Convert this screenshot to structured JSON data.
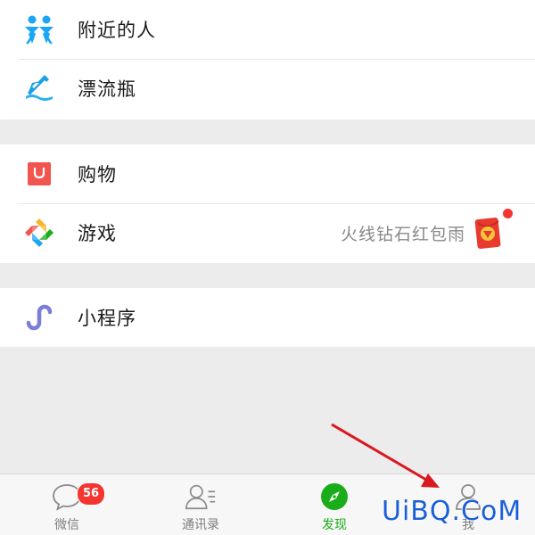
{
  "sections": [
    {
      "items": [
        {
          "label": "附近的人",
          "icon": "people-nearby-icon",
          "color": "#1ba6f5"
        },
        {
          "label": "漂流瓶",
          "icon": "drift-bottle-icon",
          "color": "#1aa0e8"
        }
      ]
    },
    {
      "items": [
        {
          "label": "购物",
          "icon": "shopping-bag-icon",
          "color": "#f0554f"
        },
        {
          "label": "游戏",
          "icon": "game-icon",
          "right_text": "火线钻石红包雨",
          "right_icon": "red-envelope-icon"
        }
      ]
    },
    {
      "items": [
        {
          "label": "小程序",
          "icon": "mini-program-icon",
          "color": "#7b7ed9"
        }
      ]
    }
  ],
  "tabbar": {
    "tabs": [
      {
        "label": "微信",
        "icon": "chat-icon",
        "badge": "56"
      },
      {
        "label": "通讯录",
        "icon": "contacts-icon"
      },
      {
        "label": "发现",
        "icon": "compass-icon",
        "active": true
      },
      {
        "label": "我",
        "icon": "me-icon"
      }
    ]
  },
  "colors": {
    "accent": "#1aad19",
    "badge": "#f43530",
    "annotation_arrow": "#d9181f"
  },
  "watermark": "UiBQ.CoM"
}
